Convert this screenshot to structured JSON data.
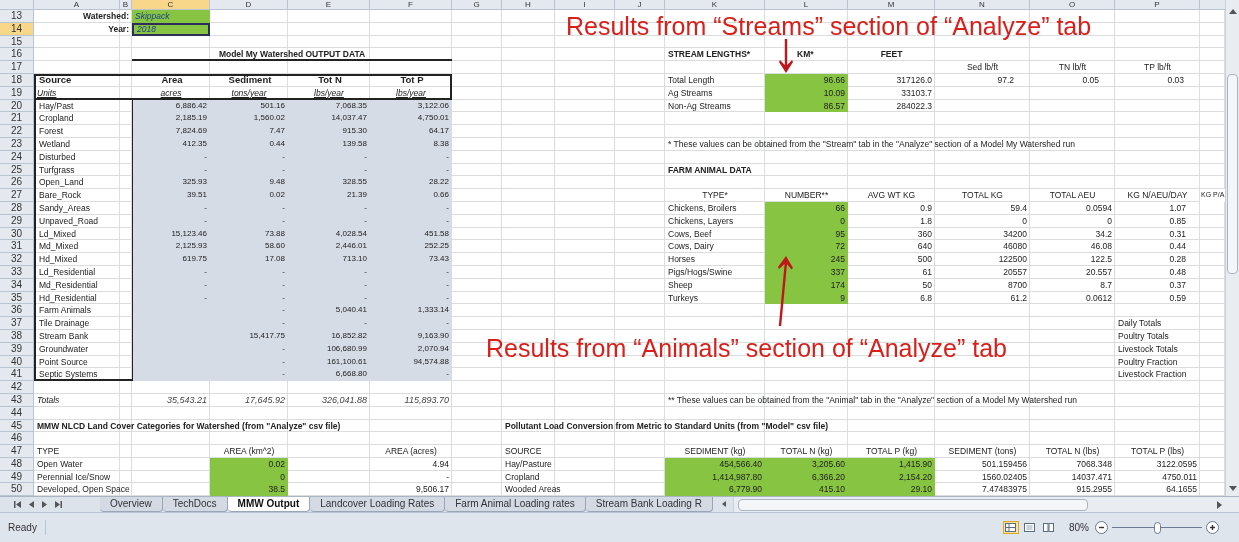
{
  "columns": [
    {
      "label": "A",
      "selected": false
    },
    {
      "label": "B",
      "selected": false
    },
    {
      "label": "C",
      "selected": true
    },
    {
      "label": "D",
      "selected": false
    },
    {
      "label": "E",
      "selected": false
    },
    {
      "label": "F",
      "selected": false
    },
    {
      "label": "G",
      "selected": false
    },
    {
      "label": "H",
      "selected": false
    },
    {
      "label": "I",
      "selected": false
    },
    {
      "label": "J",
      "selected": false
    },
    {
      "label": "K",
      "selected": false
    },
    {
      "label": "L",
      "selected": false
    },
    {
      "label": "M",
      "selected": false
    },
    {
      "label": "N",
      "selected": false
    },
    {
      "label": "O",
      "selected": false
    },
    {
      "label": "P",
      "selected": false
    }
  ],
  "row_numbers": [
    {
      "label": "13",
      "selected": false
    },
    {
      "label": "14",
      "selected": true
    },
    {
      "label": "15",
      "selected": false
    },
    {
      "label": "16",
      "selected": false
    },
    {
      "label": "17",
      "selected": false
    },
    {
      "label": "18",
      "selected": false
    },
    {
      "label": "19",
      "selected": false
    },
    {
      "label": "20",
      "selected": false
    },
    {
      "label": "21",
      "selected": false
    },
    {
      "label": "22",
      "selected": false
    },
    {
      "label": "23",
      "selected": false
    },
    {
      "label": "24",
      "selected": false
    },
    {
      "label": "25",
      "selected": false
    },
    {
      "label": "26",
      "selected": false
    },
    {
      "label": "27",
      "selected": false
    },
    {
      "label": "28",
      "selected": false
    },
    {
      "label": "29",
      "selected": false
    },
    {
      "label": "30",
      "selected": false
    },
    {
      "label": "31",
      "selected": false
    },
    {
      "label": "32",
      "selected": false
    },
    {
      "label": "33",
      "selected": false
    },
    {
      "label": "34",
      "selected": false
    },
    {
      "label": "35",
      "selected": false
    },
    {
      "label": "36",
      "selected": false
    },
    {
      "label": "37",
      "selected": false
    },
    {
      "label": "38",
      "selected": false
    },
    {
      "label": "39",
      "selected": false
    },
    {
      "label": "40",
      "selected": false
    },
    {
      "label": "41",
      "selected": false
    },
    {
      "label": "42",
      "selected": false
    },
    {
      "label": "43",
      "selected": false
    },
    {
      "label": "44",
      "selected": false
    },
    {
      "label": "45",
      "selected": false
    },
    {
      "label": "46",
      "selected": false
    },
    {
      "label": "47",
      "selected": false
    },
    {
      "label": "48",
      "selected": false
    },
    {
      "label": "49",
      "selected": false
    },
    {
      "label": "50",
      "selected": false
    }
  ],
  "watershed": {
    "label": "Watershed:",
    "value": "Skippack"
  },
  "year": {
    "label": "Year:",
    "value": "2018",
    "selected": true
  },
  "output_table": {
    "title": "Model My Watershed OUTPUT DATA",
    "headers": [
      "Source",
      "Area",
      "Sediment",
      "Tot N",
      "Tot P"
    ],
    "units": [
      "Units",
      "acres",
      "tons/year",
      "lbs/year",
      "lbs/year"
    ],
    "rows": [
      {
        "source": "Hay/Past",
        "area": "6,886.42",
        "sediment": "501.16",
        "tot_n": "7,068.35",
        "tot_p": "3,122.06"
      },
      {
        "source": "Cropland",
        "area": "2,185.19",
        "sediment": "1,560.02",
        "tot_n": "14,037.47",
        "tot_p": "4,750.01"
      },
      {
        "source": "Forest",
        "area": "7,824.69",
        "sediment": "7.47",
        "tot_n": "915.30",
        "tot_p": "64.17"
      },
      {
        "source": "Wetland",
        "area": "412.35",
        "sediment": "0.44",
        "tot_n": "139.58",
        "tot_p": "8.38"
      },
      {
        "source": "Disturbed",
        "area": "-",
        "sediment": "-",
        "tot_n": "-",
        "tot_p": "-"
      },
      {
        "source": "Turfgrass",
        "area": "-",
        "sediment": "-",
        "tot_n": "-",
        "tot_p": "-"
      },
      {
        "source": "Open_Land",
        "area": "325.93",
        "sediment": "9.48",
        "tot_n": "328.55",
        "tot_p": "28.22"
      },
      {
        "source": "Bare_Rock",
        "area": "39.51",
        "sediment": "0.02",
        "tot_n": "21.39",
        "tot_p": "0.66"
      },
      {
        "source": "Sandy_Areas",
        "area": "-",
        "sediment": "-",
        "tot_n": "-",
        "tot_p": "-"
      },
      {
        "source": "Unpaved_Road",
        "area": "-",
        "sediment": "-",
        "tot_n": "-",
        "tot_p": "-"
      },
      {
        "source": "Ld_Mixed",
        "area": "15,123.46",
        "sediment": "73.88",
        "tot_n": "4,028.54",
        "tot_p": "451.58"
      },
      {
        "source": "Md_Mixed",
        "area": "2,125.93",
        "sediment": "58.60",
        "tot_n": "2,446.01",
        "tot_p": "252.25"
      },
      {
        "source": "Hd_Mixed",
        "area": "619.75",
        "sediment": "17.08",
        "tot_n": "713.10",
        "tot_p": "73.43"
      },
      {
        "source": "Ld_Residential",
        "area": "-",
        "sediment": "-",
        "tot_n": "-",
        "tot_p": "-"
      },
      {
        "source": "Md_Residential",
        "area": "-",
        "sediment": "-",
        "tot_n": "-",
        "tot_p": "-"
      },
      {
        "source": "Hd_Residential",
        "area": "-",
        "sediment": "-",
        "tot_n": "-",
        "tot_p": "-"
      },
      {
        "source": "Farm Animals",
        "sediment": "-",
        "tot_n": "5,040.41",
        "tot_p": "1,333.14"
      },
      {
        "source": "Tile Drainage",
        "sediment": "-",
        "tot_n": "-",
        "tot_p": "-"
      },
      {
        "source": "Stream Bank",
        "sediment": "15,417.75",
        "tot_n": "16,852.82",
        "tot_p": "9,163.90"
      },
      {
        "source": "Groundwater",
        "sediment": "-",
        "tot_n": "106,680.99",
        "tot_p": "2,070.94"
      },
      {
        "source": "Point Source",
        "sediment": "-",
        "tot_n": "161,100.61",
        "tot_p": "94,574.88"
      },
      {
        "source": "Septic Systems",
        "sediment": "-",
        "tot_n": "6,668.80",
        "tot_p": "-"
      }
    ],
    "totals": {
      "label": "Totals",
      "values": [
        "35,543.21",
        "17,645.92",
        "326,041.88",
        "115,893.70"
      ]
    }
  },
  "land_cover": {
    "title": "MMW NLCD Land Cover Categories for Watershed (from \"Analyze\" csv file)",
    "headers": [
      "TYPE",
      "AREA (km^2)",
      "AREA (acres)"
    ],
    "rows": [
      {
        "type": "Open Water",
        "area_km2": "0.02",
        "area_acres": "4.94"
      },
      {
        "type": "Perennial Ice/Snow",
        "area_km2": "0",
        "area_acres": "-"
      },
      {
        "type": "Developed, Open Space",
        "area_km2": "38.5",
        "area_acres": "9,506.17"
      }
    ]
  },
  "stream_lengths": {
    "title": "STREAM LENGTHS*",
    "unit_headers": [
      "KM*",
      "FEET"
    ],
    "load_headers": [
      "Sed lb/ft",
      "TN lb/ft",
      "TP lb/ft"
    ],
    "rows": [
      {
        "name": "Total Length",
        "km": "96.66",
        "feet": "317126.0",
        "loads": [
          "97.2",
          "0.05",
          "0.03"
        ]
      },
      {
        "name": "Ag Streams",
        "km": "10.09",
        "feet": "33103.7"
      },
      {
        "name": "Non-Ag Streams",
        "km": "86.57",
        "feet": "284022.3"
      }
    ],
    "note": "* These values can be obtained from the \"Stream\" tab in the \"Analyze\" section of a Model My Watershed run"
  },
  "farm_animals": {
    "title": "FARM ANIMAL DATA",
    "headers": [
      "TYPE*",
      "NUMBER**",
      "AVG WT KG",
      "TOTAL KG",
      "TOTAL AEU",
      "KG N/AEU/DAY",
      "KG P/A"
    ],
    "rows": [
      {
        "type": "Chickens, Broilers",
        "values": [
          "66",
          "0.9",
          "59.4",
          "0.0594",
          "1.07"
        ]
      },
      {
        "type": "Chickens, Layers",
        "values": [
          "0",
          "1.8",
          "0",
          "0",
          "0.85"
        ]
      },
      {
        "type": "Cows, Beef",
        "values": [
          "95",
          "360",
          "34200",
          "34.2",
          "0.31"
        ]
      },
      {
        "type": "Cows, Dairy",
        "values": [
          "72",
          "640",
          "46080",
          "46.08",
          "0.44"
        ]
      },
      {
        "type": "Horses",
        "values": [
          "245",
          "500",
          "122500",
          "122.5",
          "0.28"
        ]
      },
      {
        "type": "Pigs/Hogs/Swine",
        "values": [
          "337",
          "61",
          "20557",
          "20.557",
          "0.48"
        ]
      },
      {
        "type": "Sheep",
        "values": [
          "174",
          "50",
          "8700",
          "8.7",
          "0.37"
        ]
      },
      {
        "type": "Turkeys",
        "values": [
          "9",
          "6.8",
          "61.2",
          "0.0612",
          "0.59"
        ]
      }
    ],
    "summary_labels": [
      "Daily Totals",
      "Poultry Totals",
      "Livestock Totals",
      "Poultry Fraction",
      "Livestock Fraction"
    ],
    "note": "** These values can be obtained from the \"Animal\" tab in the \"Analyze\" section of a Model My Watershed run"
  },
  "pollutant_conversion": {
    "title": "Pollutant Load Conversion from Metric to Standard Units (from \"Model\" csv file)",
    "headers": [
      "SOURCE",
      "SEDIMENT (kg)",
      "TOTAL N (kg)",
      "TOTAL P (kg)",
      "SEDIMENT (tons)",
      "TOTAL N (lbs)",
      "TOTAL P (lbs)"
    ],
    "rows": [
      {
        "source": "Hay/Pasture",
        "values": [
          "454,566.40",
          "3,205.60",
          "1,415.90",
          "501.159456",
          "7068.348",
          "3122.0595"
        ]
      },
      {
        "source": "Cropland",
        "values": [
          "1,414,987.80",
          "6,366.20",
          "2,154.20",
          "1560.02405",
          "14037.471",
          "4750.011"
        ]
      },
      {
        "source": "Wooded Areas",
        "values": [
          "6,779.90",
          "415.10",
          "29.10",
          "7.47483975",
          "915.2955",
          "64.1655"
        ]
      }
    ]
  },
  "annotations": [
    {
      "text": "Results from “Streams” section of “Analyze” tab",
      "kind": "down"
    },
    {
      "text": "Results from “Animals” section of “Analyze” tab",
      "kind": "up"
    }
  ],
  "sheet_tabs": [
    {
      "label": "Overview",
      "selected": false
    },
    {
      "label": "TechDocs",
      "selected": false
    },
    {
      "label": "MMW Output",
      "selected": true
    },
    {
      "label": "Landcover Loading Rates",
      "selected": false
    },
    {
      "label": "Farm Animal Loading rates",
      "selected": false
    },
    {
      "label": "Stream Bank Loading R",
      "selected": false
    }
  ],
  "status_bar": {
    "status": "Ready",
    "views": [
      {
        "kind": "normal",
        "selected": true
      },
      {
        "kind": "page_layout",
        "selected": false
      },
      {
        "kind": "page_break",
        "selected": false
      }
    ],
    "zoom": "80%",
    "zoom_slider": {
      "level": 0.5
    }
  }
}
